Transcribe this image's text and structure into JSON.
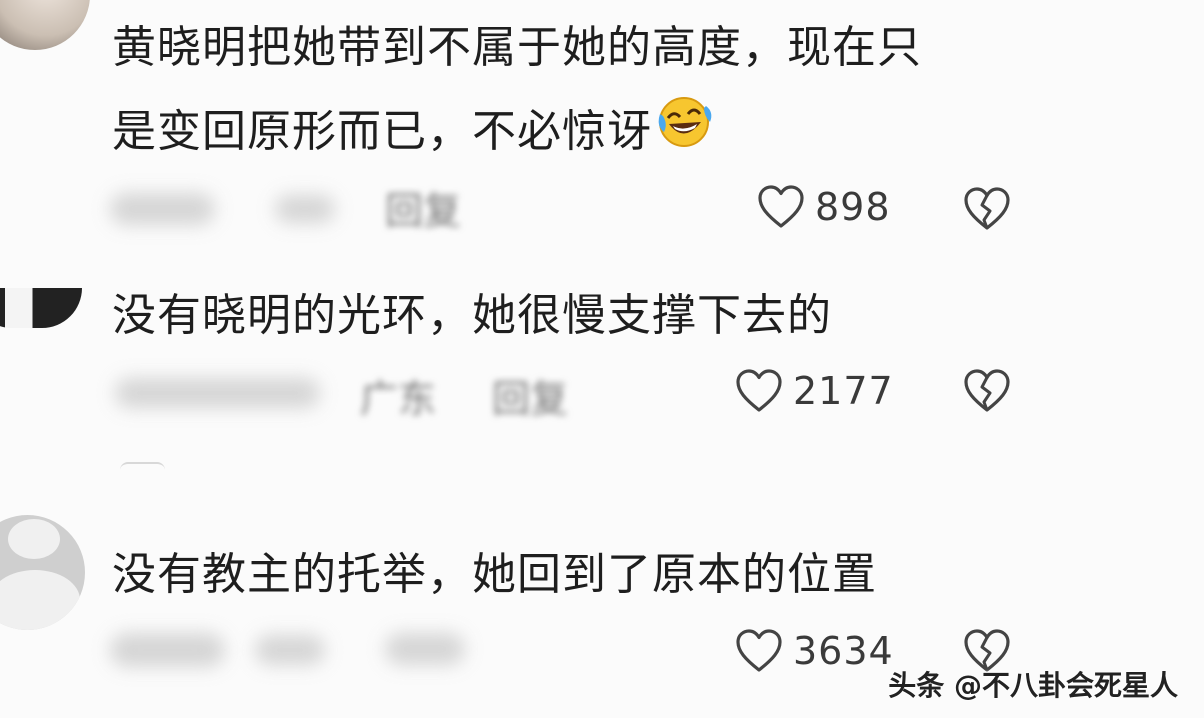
{
  "comments": [
    {
      "line1": "黄晓明把她带到不属于她的高度，现在只",
      "line2": "是变回原形而已，不必惊讶",
      "meta_action": "回复",
      "likes": "898"
    },
    {
      "line1": "没有晓明的光环，她很慢支撑下去的",
      "meta_location": "广东",
      "meta_action": "回复",
      "likes": "2177"
    },
    {
      "line1": "没有教主的托举，她回到了原本的位置",
      "likes": "3634"
    }
  ],
  "watermark": "头条 @不八卦会死星人",
  "icons": {
    "like": "heart-outline-icon",
    "dislike": "broken-heart-icon",
    "emoji": "laughing-crying-emoji"
  }
}
